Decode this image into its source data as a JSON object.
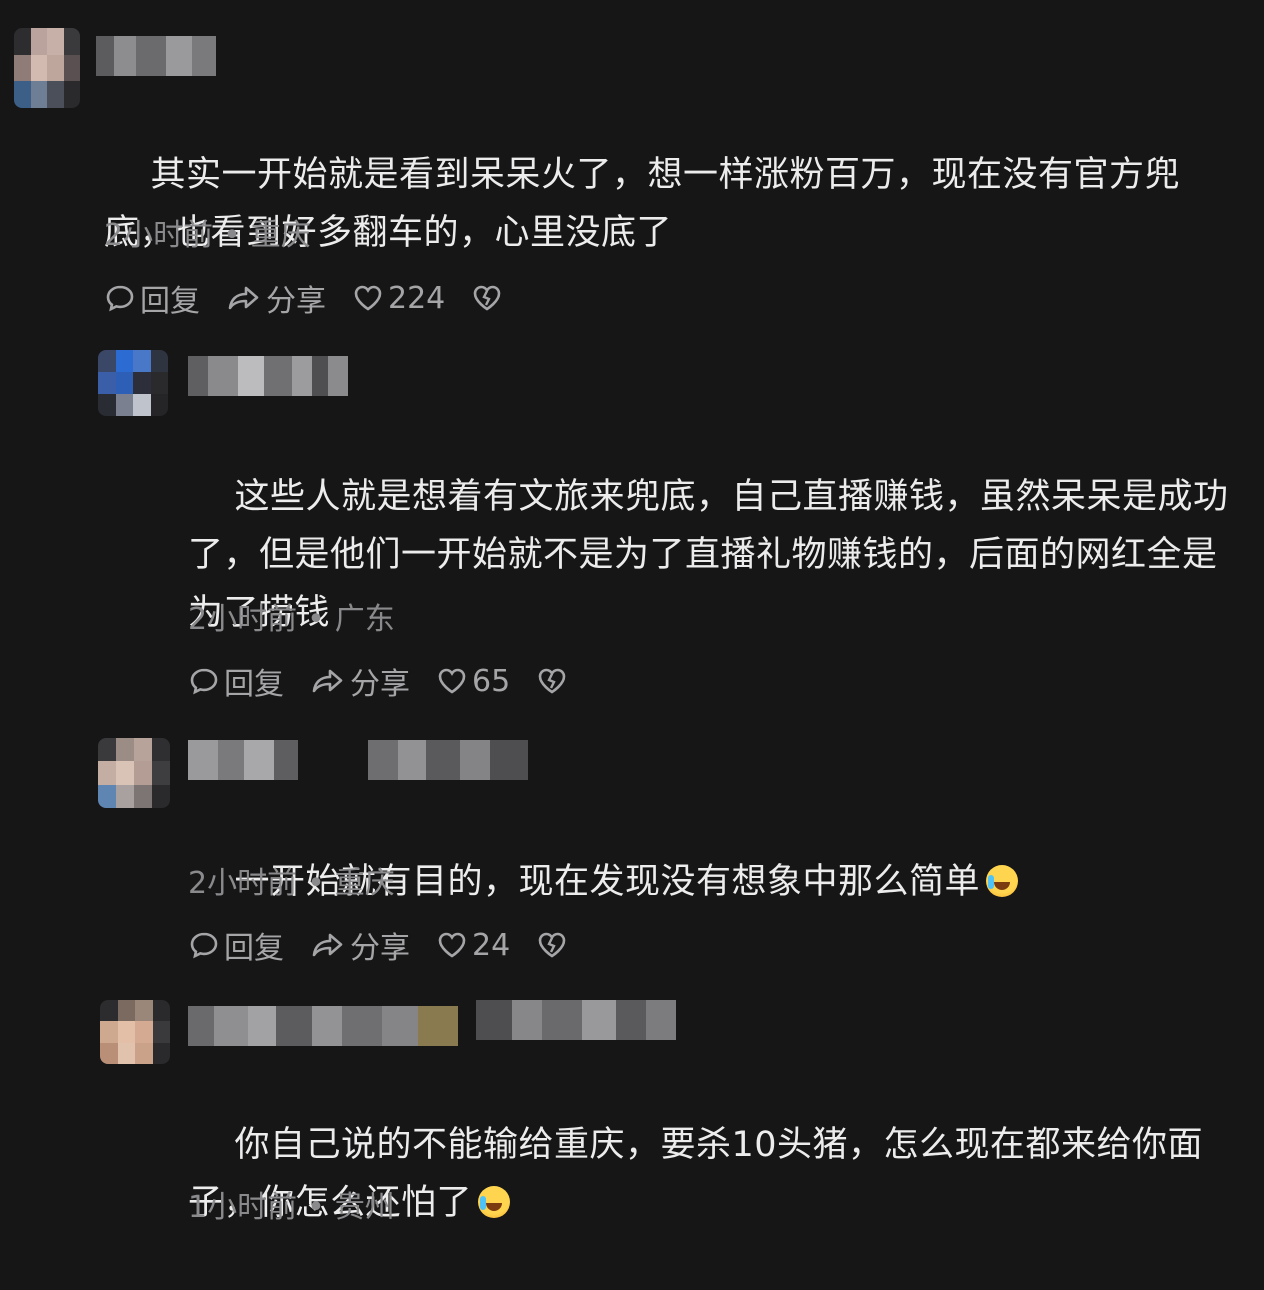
{
  "comments": [
    {
      "text": "其实一开始就是看到呆呆火了，想一样涨粉百万，现在没有官方兜底，也看到好多翻车的，心里没底了",
      "time": "2小时前",
      "location": "重庆",
      "reply_label": "回复",
      "share_label": "分享",
      "likes": "224"
    },
    {
      "text": "这些人就是想着有文旅来兜底，自己直播赚钱，虽然呆呆是成功了，但是他们一开始就不是为了直播礼物赚钱的，后面的网红全是为了捞钱",
      "time": "2小时前",
      "location": "广东",
      "reply_label": "回复",
      "share_label": "分享",
      "likes": "65"
    },
    {
      "text": "一开始就有目的，现在发现没有想象中那么简单",
      "emoji": "grinning-sweat-emoji",
      "time": "2小时前",
      "location": "重庆",
      "reply_label": "回复",
      "share_label": "分享",
      "likes": "24"
    },
    {
      "text": "你自己说的不能输给重庆，要杀10头猪，怎么现在都来给你面子，你怎么还怕了",
      "emoji": "grinning-sweat-emoji",
      "time": "1小时前",
      "location": "贵州"
    }
  ],
  "meta_separator": "•",
  "colors": {
    "background": "#161617",
    "text": "#ececed",
    "meta": "#8a8a8d",
    "action": "#a5a5a8"
  }
}
